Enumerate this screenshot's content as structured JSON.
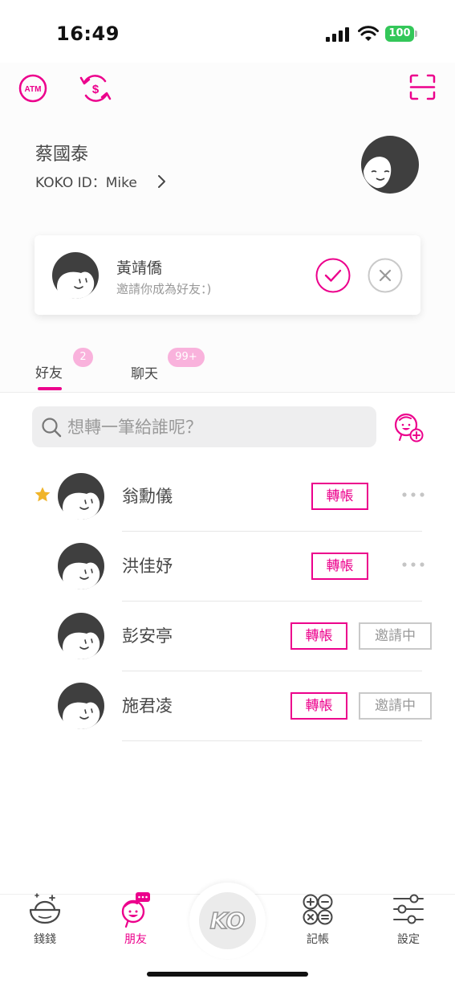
{
  "status_bar": {
    "time": "16:49",
    "battery": "100"
  },
  "header": {
    "atm_icon_text": "ATM",
    "user_name": "蔡國泰",
    "koko_id_label": "KOKO ID：Mike"
  },
  "invitation": {
    "name": "黃靖僑",
    "message": "邀請你成為好友：)"
  },
  "tabs": {
    "friends_label": "好友",
    "friends_badge": "2",
    "chat_label": "聊天",
    "chat_badge": "99+"
  },
  "search": {
    "placeholder": "想轉一筆給誰呢？",
    "value": ""
  },
  "friends": [
    {
      "name": "翁勳儀",
      "starred": true,
      "transfer_label": "轉帳",
      "status": "more"
    },
    {
      "name": "洪佳妤",
      "starred": false,
      "transfer_label": "轉帳",
      "status": "more"
    },
    {
      "name": "彭安亭",
      "starred": false,
      "transfer_label": "轉帳",
      "status": "邀請中"
    },
    {
      "name": "施君凌",
      "starred": false,
      "transfer_label": "轉帳",
      "status": "邀請中"
    }
  ],
  "bottom_nav": {
    "items": [
      {
        "label": "錢錢",
        "icon": "money-icon",
        "active": false
      },
      {
        "label": "朋友",
        "icon": "friends-icon",
        "active": true
      },
      {
        "label": "KO",
        "icon": "ko-home-icon",
        "active": false
      },
      {
        "label": "記帳",
        "icon": "accounting-icon",
        "active": false
      },
      {
        "label": "設定",
        "icon": "settings-icon",
        "active": false
      }
    ]
  },
  "colors": {
    "accent": "#ec008c",
    "badge": "#f9b2dc",
    "star": "#f0b429",
    "text": "#474747"
  }
}
